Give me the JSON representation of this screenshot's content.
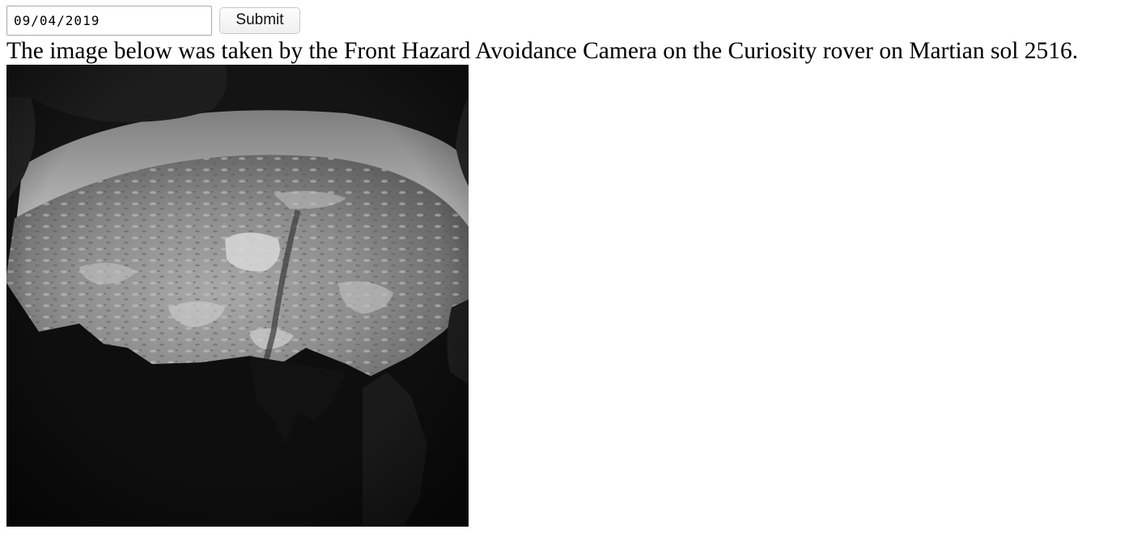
{
  "form": {
    "date_value": "09/04/2019",
    "submit_label": "Submit"
  },
  "caption": "The image below was taken by the Front Hazard Avoidance Camera on the Curiosity rover on Martian sol 2516."
}
